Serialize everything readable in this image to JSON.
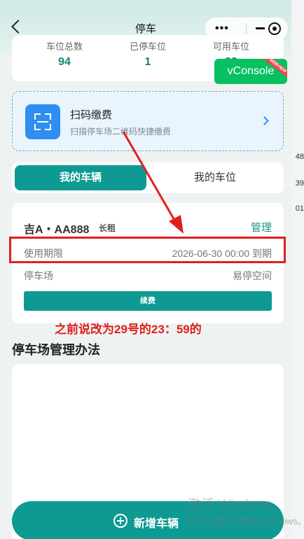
{
  "nav": {
    "title": "停车"
  },
  "stats": [
    {
      "label": "车位总数",
      "value": "94"
    },
    {
      "label": "已停车位",
      "value": "1"
    },
    {
      "label": "可用车位",
      "value": "93"
    }
  ],
  "vconsole": {
    "label": "vConsole",
    "ribbon": "WEBVIEW"
  },
  "scan": {
    "title": "扫码缴费",
    "subtitle": "扫描停车场二维码快捷缴费"
  },
  "tabs": {
    "mine_vehicles": "我的车辆",
    "mine_spaces": "我的车位"
  },
  "vehicle": {
    "plate": "吉A・AA888",
    "type": "长租",
    "manage": "管理",
    "rows": [
      {
        "label": "使用期限",
        "value": "2026-06-30 00:00 到期"
      },
      {
        "label": "停车场",
        "value": "易停空间"
      }
    ],
    "renew": "续费"
  },
  "annotation": {
    "text": "之前说改为29号的23：59的",
    "color": "#e0201e"
  },
  "rules": {
    "title": "停车场管理办法"
  },
  "add_button": {
    "label": "新增车辆"
  },
  "watermark": {
    "line1": "激活 Windows",
    "line2": "转到\"设置\"以激活 Windows。"
  },
  "backdrop_fragments": [
    "48",
    "39",
    "01"
  ],
  "colors": {
    "primary": "#0e9a93",
    "stat_value": "#1b7f78",
    "link": "#2f8ff0",
    "vconsole": "#07c160"
  }
}
